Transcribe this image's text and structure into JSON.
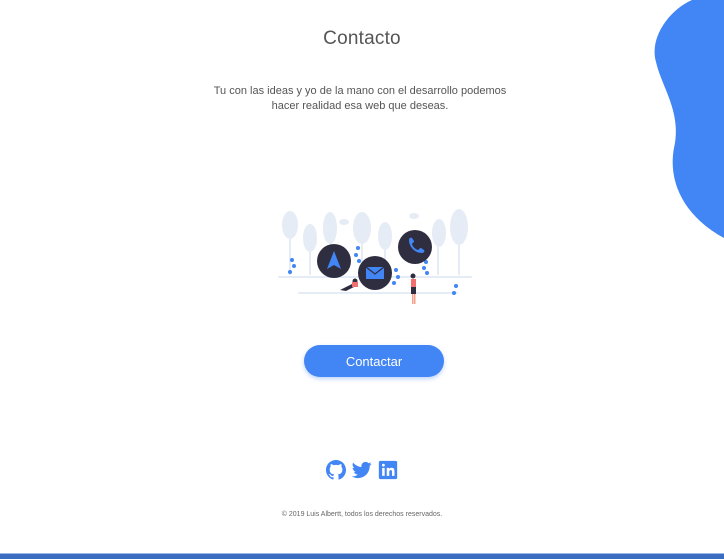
{
  "contact": {
    "title": "Contacto",
    "description_line1": "Tu con las ideas y yo de la mano con el desarrollo podemos",
    "description_line2": "hacer realidad esa web que deseas.",
    "button_label": "Contactar"
  },
  "social": [
    "github-icon",
    "twitter-icon",
    "linkedin-icon"
  ],
  "footer": {
    "copyright": "© 2019  Luis Albertt, todos los derechos reservados."
  },
  "colors": {
    "accent": "#4285f4",
    "text": "#555555",
    "dark_circle": "#2f2e41"
  }
}
